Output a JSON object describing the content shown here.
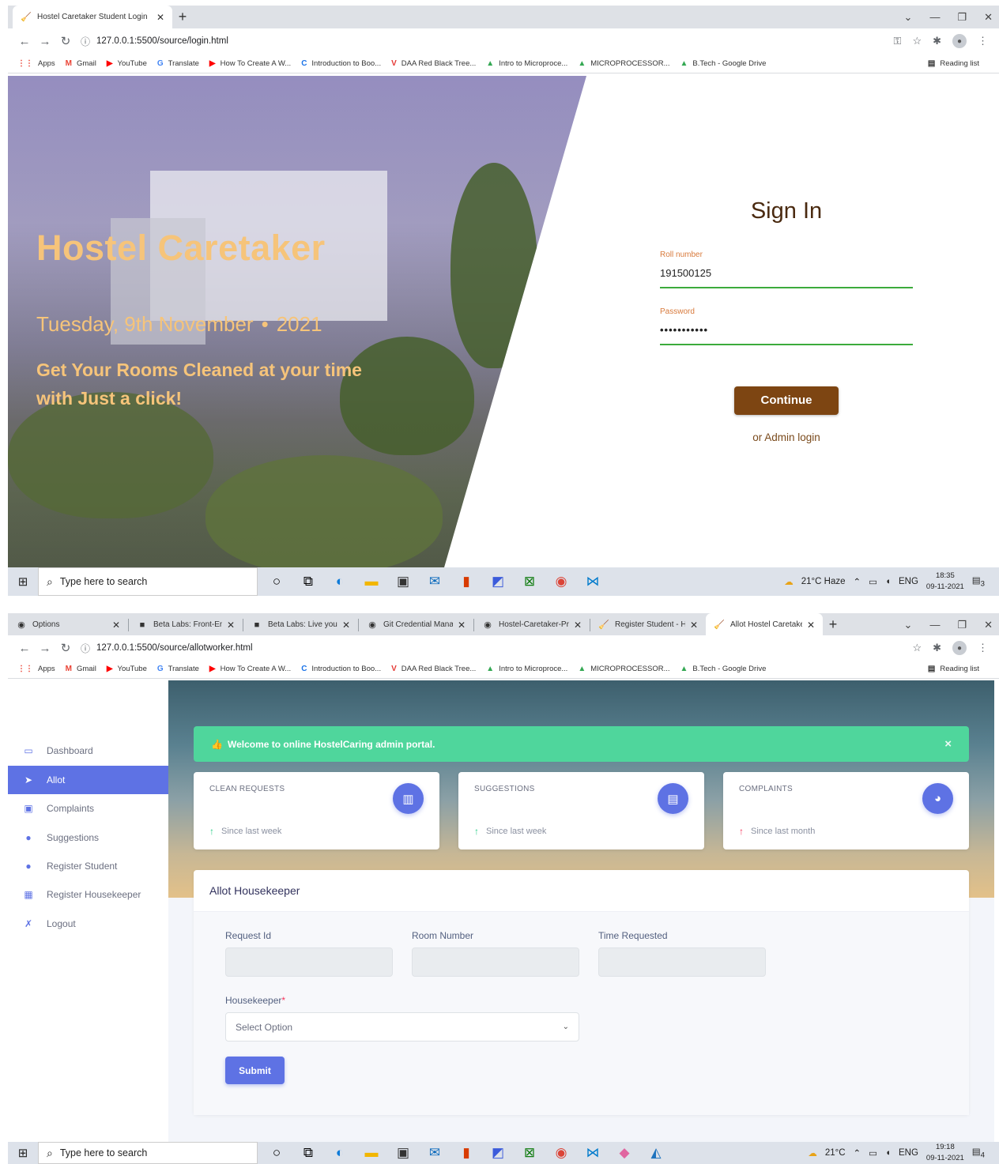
{
  "login_window": {
    "tab_title": "Hostel Caretaker Student Login",
    "url": "127.0.0.1:5500/source/login.html",
    "hero": {
      "title": "Hostel Caretaker",
      "date_day": "Tuesday, 9th November",
      "date_separator": "•",
      "date_year": "2021",
      "tagline": "Get Your Rooms Cleaned at your time with Just a click!"
    },
    "signin": {
      "title": "Sign In",
      "roll_label": "Roll number",
      "roll_value": "191500125",
      "password_label": "Password",
      "password_value": "•••••••••••",
      "continue_label": "Continue",
      "admin_link": "or Admin login"
    },
    "taskbar": {
      "search_placeholder": "Type here to search",
      "weather": "21°C  Haze",
      "lang": "ENG",
      "time": "18:35",
      "date": "09-11-2021",
      "notif_count": "3"
    }
  },
  "bookmarks": [
    {
      "label": "Apps",
      "icon": "apps-grid-icon",
      "color": "#ea4335",
      "glyph": "⋮⋮"
    },
    {
      "label": "Gmail",
      "icon": "gmail-icon",
      "color": "#ea4335",
      "glyph": "M"
    },
    {
      "label": "YouTube",
      "icon": "youtube-icon",
      "color": "#ff0000",
      "glyph": "▶"
    },
    {
      "label": "Translate",
      "icon": "translate-icon",
      "color": "#4285f4",
      "glyph": "G"
    },
    {
      "label": "How To Create A W...",
      "icon": "youtube-icon",
      "color": "#ff0000",
      "glyph": "▶"
    },
    {
      "label": "Introduction to Boo...",
      "icon": "circle-c-icon",
      "color": "#1a73e8",
      "glyph": "C"
    },
    {
      "label": "DAA Red Black Tree...",
      "icon": "v-logo-icon",
      "color": "#e53935",
      "glyph": "V"
    },
    {
      "label": "Intro to Microproce...",
      "icon": "drive-icon",
      "color": "#34a853",
      "glyph": "▲"
    },
    {
      "label": "MICROPROCESSOR...",
      "icon": "drive-icon",
      "color": "#34a853",
      "glyph": "▲"
    },
    {
      "label": "B.Tech - Google Drive",
      "icon": "drive-icon",
      "color": "#34a853",
      "glyph": "▲"
    }
  ],
  "bookmarks_reading_list": "Reading list",
  "admin_window": {
    "tabs": [
      {
        "title": "Options",
        "icon": "github-icon",
        "glyph": "◉"
      },
      {
        "title": "Beta Labs: Front-End",
        "icon": "beta-labs-icon",
        "glyph": "■"
      },
      {
        "title": "Beta Labs: Live your V",
        "icon": "beta-labs-icon",
        "glyph": "■"
      },
      {
        "title": "Git Credential Manag",
        "icon": "github-icon",
        "glyph": "◉"
      },
      {
        "title": "Hostel-Caretaker-Proj",
        "icon": "github-icon",
        "glyph": "◉"
      },
      {
        "title": "Register Student - Ho",
        "icon": "broom-icon",
        "glyph": "🧹"
      },
      {
        "title": "Allot Hostel Caretake",
        "icon": "broom-icon",
        "glyph": "🧹"
      }
    ],
    "url": "127.0.0.1:5500/source/allotworker.html",
    "sidebar": [
      {
        "label": "Dashboard",
        "icon": "monitor-icon",
        "glyph": "▭",
        "color": "ic-blue"
      },
      {
        "label": "Allot",
        "icon": "send-icon",
        "glyph": "➤",
        "color": ""
      },
      {
        "label": "Complaints",
        "icon": "clipboard-icon",
        "glyph": "▣",
        "color": "ic-blue"
      },
      {
        "label": "Suggestions",
        "icon": "bulb-icon",
        "glyph": "●",
        "color": "ic-blue"
      },
      {
        "label": "Register Student",
        "icon": "user-icon",
        "glyph": "●",
        "color": "ic-blue"
      },
      {
        "label": "Register Housekeeper",
        "icon": "id-card-icon",
        "glyph": "▦",
        "color": "ic-blue"
      },
      {
        "label": "Logout",
        "icon": "logout-icon",
        "glyph": "✗",
        "color": "ic-blue"
      }
    ],
    "alert": {
      "icon": "thumbs-up-icon",
      "text": "Welcome to online HostelCaring admin portal.",
      "close": "×"
    },
    "stats": [
      {
        "title": "CLEAN REQUESTS",
        "icon": "bar-chart-icon",
        "glyph": "▥",
        "foot": "Since last week",
        "trend": "up"
      },
      {
        "title": "SUGGESTIONS",
        "icon": "document-icon",
        "glyph": "▤",
        "foot": "Since last week",
        "trend": "up"
      },
      {
        "title": "COMPLAINTS",
        "icon": "pie-chart-icon",
        "glyph": "◕",
        "foot": "Since last month",
        "trend": "up"
      }
    ],
    "form": {
      "title": "Allot Housekeeper",
      "request_id_label": "Request Id",
      "room_number_label": "Room Number",
      "time_requested_label": "Time Requested",
      "housekeeper_label": "Housekeeper",
      "required_mark": "*",
      "housekeeper_placeholder": "Select Option",
      "submit_label": "Submit"
    },
    "taskbar": {
      "search_placeholder": "Type here to search",
      "weather": "21°C",
      "lang": "ENG",
      "time": "19:18",
      "date": "09-11-2021",
      "notif_count": "4"
    }
  }
}
